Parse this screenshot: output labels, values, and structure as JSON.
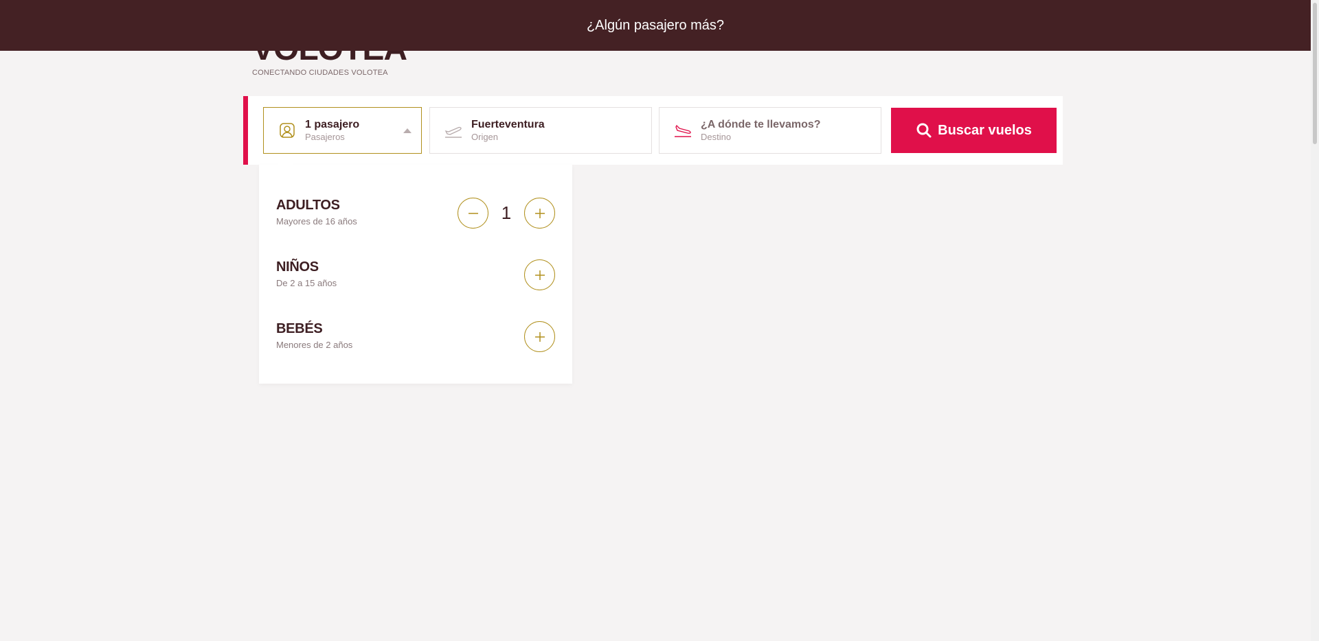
{
  "banner": {
    "text": "¿Algún pasajero más?"
  },
  "logo": {
    "wordmark": "VOLOTEA",
    "tagline": "CONECTANDO CIUDADES VOLOTEA"
  },
  "search": {
    "passengers": {
      "value": "1 pasajero",
      "label": "Pasajeros",
      "icon": "user-icon"
    },
    "origin": {
      "value": "Fuerteventura",
      "label": "Origen",
      "icon": "plane-takeoff-icon"
    },
    "destination": {
      "placeholder": "¿A dónde te llevamos?",
      "label": "Destino",
      "icon": "plane-landing-icon"
    },
    "button_label": "Buscar vuelos"
  },
  "passenger_dropdown": {
    "rows": [
      {
        "title": "ADULTOS",
        "desc": "Mayores de 16 años",
        "count": "1"
      },
      {
        "title": "NIÑOS",
        "desc": "De 2 a 15 años"
      },
      {
        "title": "BEBÉS",
        "desc": "Menores de 2 años"
      }
    ]
  },
  "colors": {
    "accent": "#e0104a",
    "banner": "#442124",
    "gold": "#b08f1b",
    "text": "#3d1e22"
  }
}
